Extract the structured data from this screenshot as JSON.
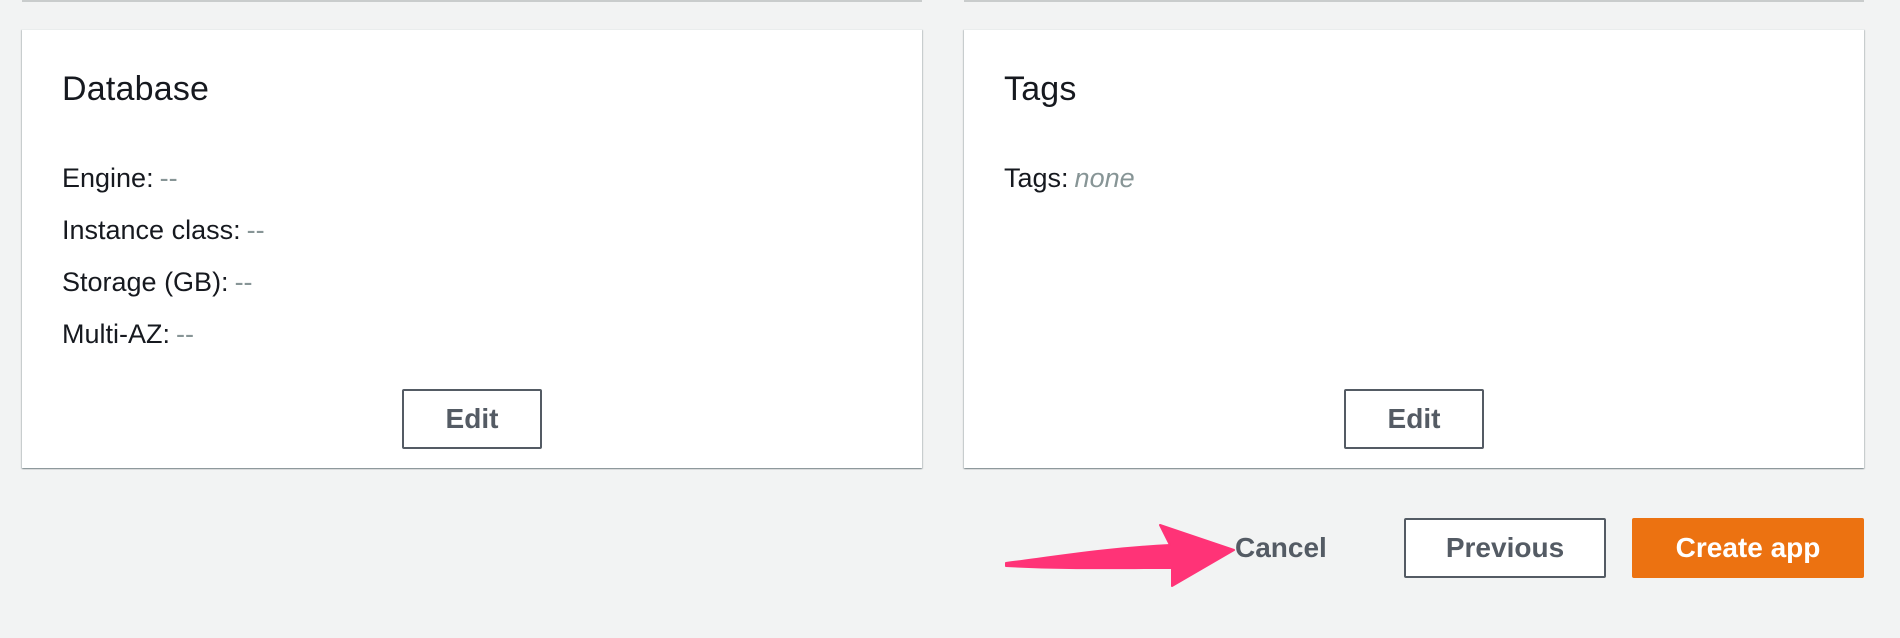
{
  "database_card": {
    "title": "Database",
    "fields": [
      {
        "label": "Engine:",
        "value": "--"
      },
      {
        "label": "Instance class:",
        "value": "--"
      },
      {
        "label": "Storage (GB):",
        "value": "--"
      },
      {
        "label": "Multi-AZ:",
        "value": "--"
      }
    ],
    "edit_label": "Edit"
  },
  "tags_card": {
    "title": "Tags",
    "fields": [
      {
        "label": "Tags:",
        "value": "none"
      }
    ],
    "edit_label": "Edit"
  },
  "footer": {
    "cancel_label": "Cancel",
    "previous_label": "Previous",
    "create_label": "Create app"
  },
  "colors": {
    "background": "#f2f3f3",
    "primary_button": "#ec7211",
    "annotation_arrow": "#ff3377",
    "muted_value": "#879596"
  },
  "annotation": {
    "arrow_icon": "pointer-arrow-icon",
    "points_to": "cancel-button"
  }
}
